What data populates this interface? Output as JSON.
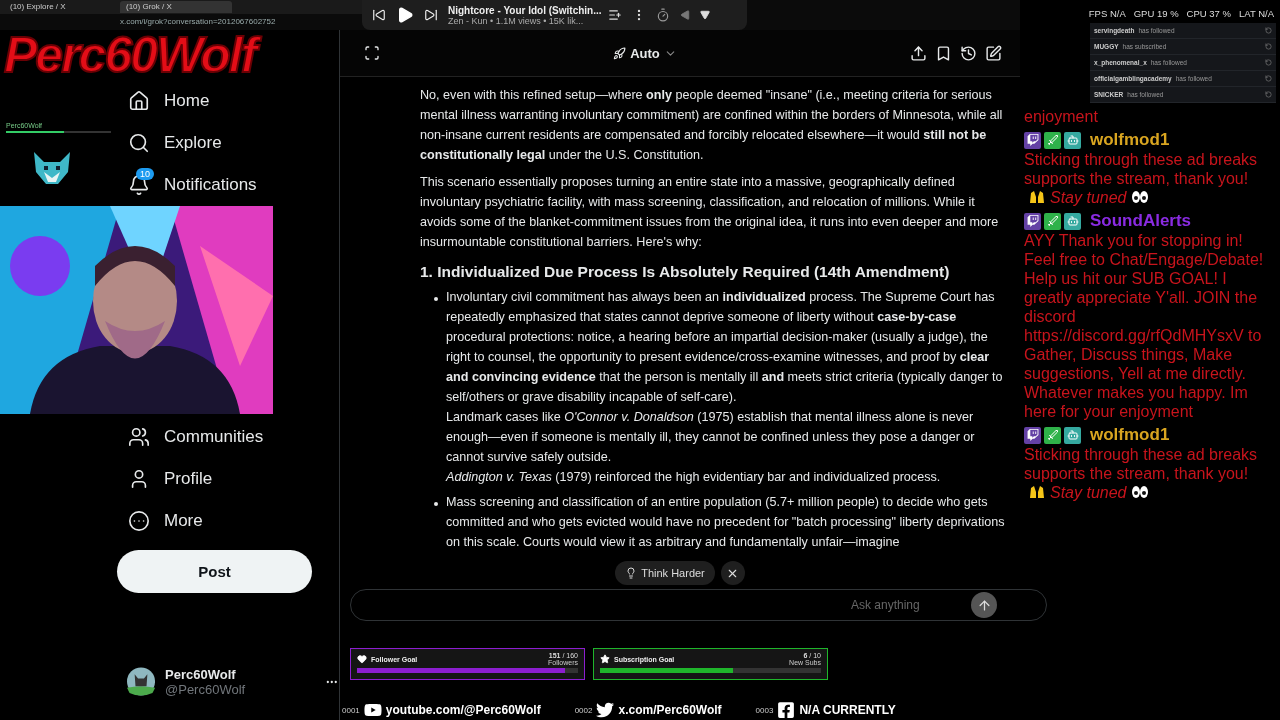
{
  "overlay_logo": "Perc60Wolf",
  "mini_widget": {
    "name": "Perc60Wolf",
    "level": 0.55
  },
  "browser": {
    "tabs": [
      {
        "title": "(10) Explore / X",
        "selected": false
      },
      {
        "title": "(10) Grok / X",
        "selected": true
      }
    ],
    "url": "x.com/i/grok?conversation=2012067602752"
  },
  "media_player": {
    "title": "Nightcore - Your Idol (Switchin...",
    "meta": "Zen - Kun • 1.1M views • 15K lik..."
  },
  "sidebar": {
    "nav_top": [
      {
        "label": "Home",
        "kind": "home"
      },
      {
        "label": "Explore",
        "kind": "search"
      },
      {
        "label": "Notifications",
        "kind": "bell",
        "badge": "10"
      }
    ],
    "nav_bottom": [
      {
        "label": "Communities",
        "kind": "communities"
      },
      {
        "label": "Profile",
        "kind": "profile"
      },
      {
        "label": "More",
        "kind": "more"
      }
    ],
    "post_button": "Post",
    "account": {
      "name": "Perc60Wolf",
      "handle": "@Perc60Wolf"
    }
  },
  "toolbar": {
    "model": "Auto"
  },
  "article": [
    {
      "kind": "paragraph",
      "text": "No, even with this refined setup—where **only** people deemed \"insane\" (i.e., meeting criteria for serious mental illness warranting involuntary commitment) are confined within the borders of Minnesota, while all non-insane current residents are compensated and forcibly relocated elsewhere—it would **still not be constitutionally legal** under the U.S. Constitution."
    },
    {
      "kind": "paragraph",
      "text": "This scenario essentially proposes turning an entire state into a massive, geographically defined involuntary psychiatric facility, with mass screening, classification, and relocation of millions. While it avoids some of the blanket-commitment issues from the original idea, it runs into even deeper and more insurmountable constitutional barriers. Here's why:"
    },
    {
      "kind": "heading",
      "text": "1. Individualized Due Process Is Absolutely Required (14th Amendment)"
    },
    {
      "kind": "bullet",
      "lines": [
        "Involuntary civil commitment has always been an **individualized** process. The Supreme Court has repeatedly emphasized that states cannot deprive someone of liberty without **case-by-case** procedural protections: notice, a hearing before an impartial decision-maker (usually a judge), the right to counsel, the opportunity to present evidence/cross-examine witnesses, and proof by **clear and convincing evidence** that the person is mentally ill **and** meets strict criteria (typically danger to self/others or grave disability incapable of self-care).",
        "Landmark cases like *O'Connor v. Donaldson* (1975) establish that mental illness alone is never enough—even if someone is mentally ill, they cannot be confined unless they pose a danger or cannot survive safely outside.",
        "*Addington v. Texas* (1979) reinforced the high evidentiary bar and individualized process."
      ]
    },
    {
      "kind": "bullet",
      "lines": [
        "Mass screening and classification of an entire population (5.7+ million people) to decide who gets committed and who gets evicted would have no precedent for \"batch processing\" liberty deprivations on this scale. Courts would view it as arbitrary and fundamentally unfair—imagine"
      ]
    }
  ],
  "think_harder": {
    "label": "Think Harder"
  },
  "composer": {
    "placeholder": "Ask anything"
  },
  "goals": [
    {
      "title": "Follower Goal",
      "count": "**151** / 160",
      "unit": "Followers",
      "level": 0.94,
      "color": "#8c1ed0"
    },
    {
      "title": "Subscription Goal",
      "count": "**6** / 10",
      "unit": "New Subs",
      "level": 0.6,
      "color": "#1fb52b"
    }
  ],
  "social": [
    {
      "kind": "youtube",
      "label": "youtube.com/@Perc60Wolf",
      "marker": "0001"
    },
    {
      "kind": "twitter",
      "label": "x.com/Perc60Wolf",
      "marker": "0002"
    },
    {
      "kind": "facebook",
      "label": "N/A CURRENTLY",
      "marker": "0003"
    }
  ],
  "stats": [
    {
      "label": "FPS",
      "value": "N/A"
    },
    {
      "label": "GPU",
      "value": "19 %"
    },
    {
      "label": "CPU",
      "value": "37 %"
    },
    {
      "label": "LAT",
      "value": "N/A"
    }
  ],
  "activity": [
    {
      "user": "servingdeath",
      "action": "has followed"
    },
    {
      "user": "MUGGY",
      "action": "has subscribed"
    },
    {
      "user": "x_phenomenal_x",
      "action": "has followed"
    },
    {
      "user": "officialgamblingacademy",
      "action": "has followed"
    },
    {
      "user": "SNICKER",
      "action": "has followed"
    }
  ],
  "chat": {
    "fragment": "enjoyment",
    "messages": [
      {
        "user": "wolfmod1",
        "color": "#d9a520",
        "parts": [
          {
            "kind": "text",
            "text": "Sticking through these ad breaks supports the stream, thank you!"
          },
          {
            "kind": "hands"
          },
          {
            "kind": "italic",
            "text": "Stay tuned"
          },
          {
            "kind": "eyes"
          }
        ]
      },
      {
        "user": "SoundAlerts",
        "color": "#8a2be2",
        "parts": [
          {
            "kind": "text",
            "text": "AYY Thank you for stopping in! Feel free to Chat/Engage/Debate! Help us hit our SUB GOAL! I greatly appreciate Y'all. JOIN the discord https://discord.gg/rfQdMHYsxV to Gather, Discuss things, Make suggestions, Yell at me directly. Whatever makes you happy. Im here for your enjoyment"
          }
        ]
      },
      {
        "user": "wolfmod1",
        "color": "#d9a520",
        "parts": [
          {
            "kind": "text",
            "text": "Sticking through these ad breaks supports the stream, thank you!"
          },
          {
            "kind": "hands"
          },
          {
            "kind": "italic",
            "text": "Stay tuned"
          },
          {
            "kind": "eyes"
          }
        ]
      }
    ]
  }
}
